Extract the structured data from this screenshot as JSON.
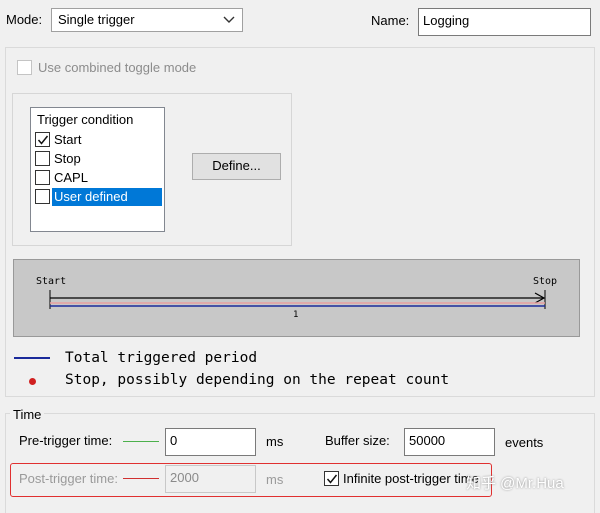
{
  "mode": {
    "label": "Mode:",
    "value": "Single trigger"
  },
  "name": {
    "label": "Name:",
    "value": "Logging"
  },
  "combined_toggle": {
    "label": "Use combined toggle mode",
    "checked": false
  },
  "trigger_condition": {
    "title": "Trigger condition",
    "items": [
      {
        "label": "Start",
        "checked": true
      },
      {
        "label": "Stop",
        "checked": false
      },
      {
        "label": "CAPL",
        "checked": false
      },
      {
        "label": "User defined",
        "checked": false,
        "selected": true
      }
    ]
  },
  "define_button": {
    "label": "Define..."
  },
  "diagram": {
    "start_label": "Start",
    "stop_label": "Stop",
    "segment_label": "1"
  },
  "legend": {
    "items": [
      {
        "text": "Total triggered period",
        "color": "#1a2a9a"
      },
      {
        "text": "Stop, possibly depending on the repeat count",
        "color": "#d02020"
      }
    ]
  },
  "time": {
    "title": "Time",
    "pre_trigger": {
      "label": "Pre-trigger time:",
      "value": "0",
      "unit": "ms",
      "line_color": "#4cb04c"
    },
    "buffer_size": {
      "label": "Buffer size:",
      "value": "50000",
      "unit": "events"
    },
    "post_trigger": {
      "label": "Post-trigger time:",
      "value": "2000",
      "unit": "ms",
      "line_color": "#d03030"
    },
    "infinite_post_trigger": {
      "label": "Infinite post-trigger time",
      "checked": true
    }
  },
  "watermark": "知乎 @Mr.Hua"
}
